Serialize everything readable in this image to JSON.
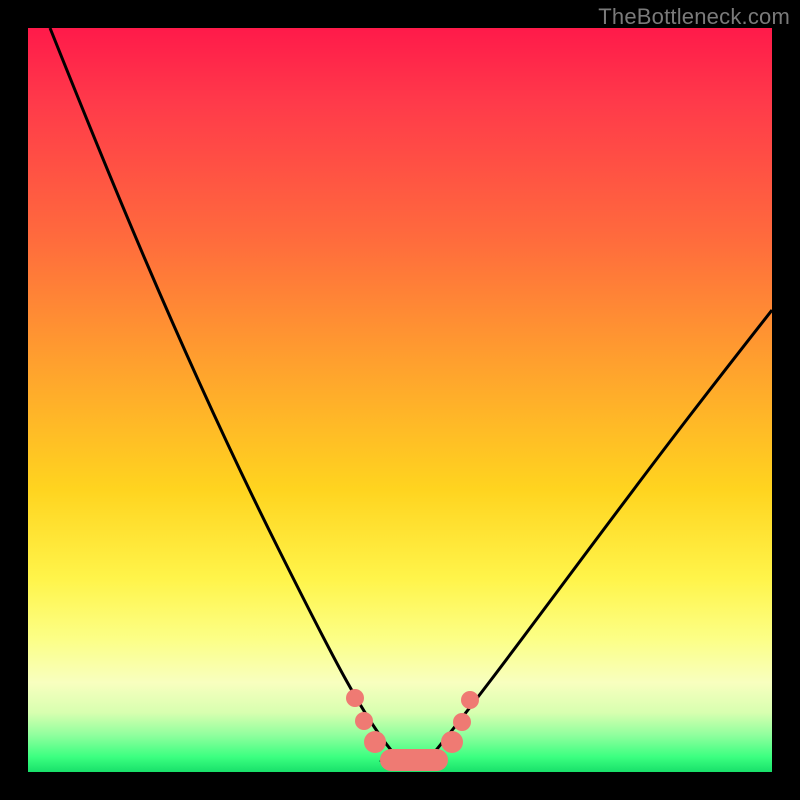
{
  "watermark": {
    "text": "TheBottleneck.com"
  },
  "chart_data": {
    "type": "line",
    "title": "",
    "xlabel": "",
    "ylabel": "",
    "xlim": [
      0,
      100
    ],
    "ylim": [
      0,
      100
    ],
    "grid": false,
    "legend": false,
    "series": [
      {
        "name": "bottleneck-curve",
        "color": "#000000",
        "x": [
          3,
          8,
          14,
          20,
          26,
          31,
          36,
          40,
          44,
          46,
          48,
          50,
          52,
          54,
          56,
          58,
          62,
          68,
          75,
          83,
          92,
          100
        ],
        "y": [
          100,
          88,
          74,
          60,
          46,
          34,
          24,
          15,
          8,
          4,
          2,
          1,
          1,
          2,
          4,
          7,
          12,
          20,
          30,
          41,
          52,
          62
        ]
      }
    ],
    "markers": {
      "color": "#ef7a73",
      "points": [
        {
          "x": 44.0,
          "y": 10.0
        },
        {
          "x": 45.5,
          "y": 6.5
        },
        {
          "x": 47.0,
          "y": 4.0
        },
        {
          "x": 56.5,
          "y": 4.0
        },
        {
          "x": 58.0,
          "y": 7.0
        },
        {
          "x": 59.0,
          "y": 10.0
        }
      ],
      "flat_segment": {
        "x_start": 47.5,
        "x_end": 56.0,
        "y": 1.5
      }
    },
    "background_gradient": {
      "stops": [
        {
          "pos": 0.0,
          "color": "#ff1a4a"
        },
        {
          "pos": 0.28,
          "color": "#ff6a3d"
        },
        {
          "pos": 0.62,
          "color": "#ffd41f"
        },
        {
          "pos": 0.88,
          "color": "#f8ffbf"
        },
        {
          "pos": 1.0,
          "color": "#18e06a"
        }
      ]
    }
  }
}
